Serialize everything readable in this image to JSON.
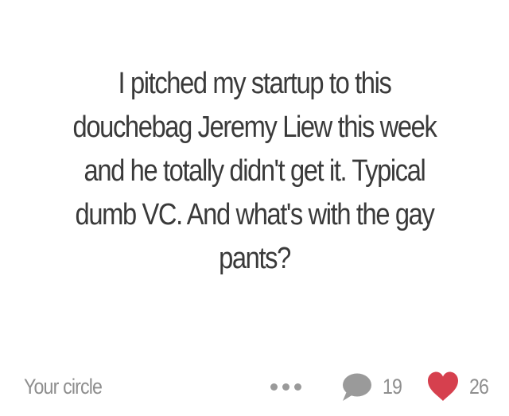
{
  "post": {
    "text": "I pitched my startup to this douchebag Jeremy Liew this week and he totally didn't get it. Typical dumb VC. And what's with the gay pants?"
  },
  "footer": {
    "circle_label": "Your circle",
    "more_icon": "more-dots-icon",
    "comment_icon": "speech-bubble-icon",
    "comment_count": "19",
    "like_icon": "heart-icon",
    "like_count": "26"
  },
  "colors": {
    "text": "#3a3a3a",
    "muted": "#8e8e8e",
    "icon_gray": "#9a9a9a",
    "heart": "#d6404e",
    "background": "#ffffff"
  }
}
